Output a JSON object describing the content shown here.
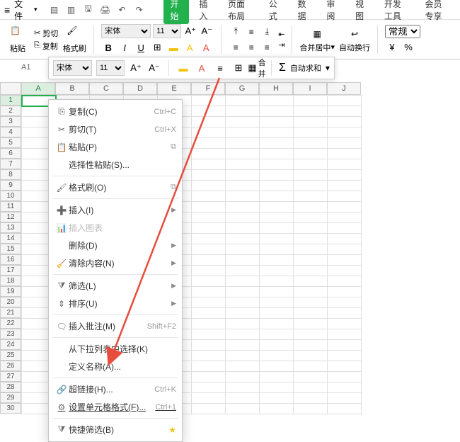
{
  "titlebar": {
    "file_label": "文件"
  },
  "tabs": [
    "开始",
    "插入",
    "页面布局",
    "公式",
    "数据",
    "审阅",
    "视图",
    "开发工具",
    "会员专享"
  ],
  "active_tab": 0,
  "ribbon": {
    "paste_label": "粘贴",
    "cut_label": "剪切",
    "copy_label": "复制",
    "format_painter_label": "格式刷",
    "font_name": "宋体",
    "font_size": "11",
    "merge_center": "合并居中",
    "wrap_text": "自动换行",
    "number_format": "常规"
  },
  "float_toolbar": {
    "font_name": "宋体",
    "font_size": "11",
    "autosum": "自动求和"
  },
  "cell_ref": "A1",
  "columns": [
    "A",
    "B",
    "C",
    "D",
    "E",
    "F",
    "G",
    "H",
    "I",
    "J"
  ],
  "row_count": 30,
  "selected_cell": {
    "row": 1,
    "col": 0
  },
  "context_menu": {
    "items": [
      {
        "icon": "⎘",
        "label": "复制(C)",
        "shortcut": "Ctrl+C",
        "interact": true
      },
      {
        "icon": "✂",
        "label": "剪切(T)",
        "shortcut": "Ctrl+X",
        "interact": true
      },
      {
        "icon": "📋",
        "label": "粘贴(P)",
        "shortcut": "",
        "trail_ico": "⧉",
        "interact": true
      },
      {
        "icon": "",
        "label": "选择性粘贴(S)...",
        "shortcut": "",
        "interact": true
      },
      {
        "sep": true
      },
      {
        "icon": "🖌",
        "label": "格式刷(O)",
        "shortcut": "",
        "trail_ico": "⧉",
        "interact": true
      },
      {
        "sep": true
      },
      {
        "icon": "➕",
        "label": "插入(I)",
        "shortcut": "",
        "arrow": true,
        "interact": true
      },
      {
        "icon": "📊",
        "label": "插入图表",
        "shortcut": "",
        "disabled": true,
        "interact": false
      },
      {
        "icon": "",
        "label": "删除(D)",
        "shortcut": "",
        "arrow": true,
        "interact": true
      },
      {
        "icon": "🧹",
        "label": "清除内容(N)",
        "shortcut": "",
        "arrow": true,
        "interact": true
      },
      {
        "sep": true
      },
      {
        "icon": "⧩",
        "label": "筛选(L)",
        "shortcut": "",
        "arrow": true,
        "interact": true
      },
      {
        "icon": "⇕",
        "label": "排序(U)",
        "shortcut": "",
        "arrow": true,
        "interact": true
      },
      {
        "sep": true
      },
      {
        "icon": "🗨",
        "label": "插入批注(M)",
        "shortcut": "Shift+F2",
        "interact": true
      },
      {
        "sep": true
      },
      {
        "icon": "",
        "label": "从下拉列表中选择(K)",
        "shortcut": "",
        "interact": true
      },
      {
        "icon": "",
        "label": "定义名称(A)...",
        "shortcut": "",
        "interact": true
      },
      {
        "sep": true
      },
      {
        "icon": "🔗",
        "label": "超链接(H)...",
        "shortcut": "Ctrl+K",
        "interact": true
      },
      {
        "icon": "⚙",
        "label": "设置单元格格式(F)...",
        "shortcut": "Ctrl+1",
        "highlight": true,
        "interact": true
      },
      {
        "sep": true
      },
      {
        "icon": "⧩",
        "label": "快捷筛选(B)",
        "shortcut": "",
        "star": true,
        "interact": true
      }
    ]
  }
}
